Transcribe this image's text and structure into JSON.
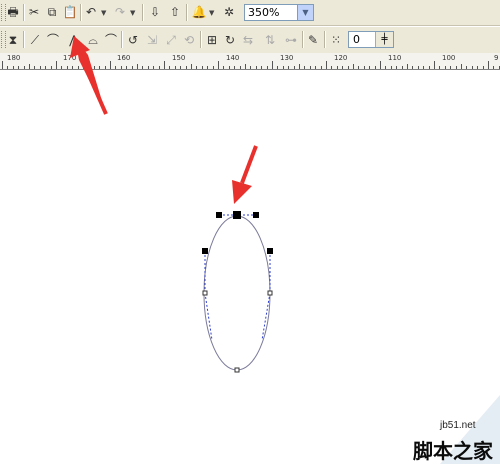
{
  "toolbar_standard": {
    "items": [
      {
        "name": "print-icon",
        "glyph": "🖶"
      },
      {
        "name": "cut-icon",
        "glyph": "✂"
      },
      {
        "name": "copy-icon",
        "glyph": "⧉"
      },
      {
        "name": "paste-icon",
        "glyph": "📋"
      },
      {
        "name": "undo-icon",
        "glyph": "↶"
      },
      {
        "name": "redo-icon",
        "glyph": "↷"
      },
      {
        "name": "import-icon",
        "glyph": "⇩"
      },
      {
        "name": "export-icon",
        "glyph": "⇧"
      },
      {
        "name": "application-launcher-icon",
        "glyph": "🔔"
      },
      {
        "name": "welcome-screen-icon",
        "glyph": "✲"
      }
    ],
    "zoom_value": "350%"
  },
  "toolbar_property": {
    "items": [
      {
        "name": "node-select-icon",
        "glyph": "⧗"
      },
      {
        "name": "to-line-icon",
        "glyph": "⟋"
      },
      {
        "name": "to-curve-icon",
        "glyph": "⌒"
      },
      {
        "name": "make-node-cusp-icon",
        "glyph": "⋀"
      },
      {
        "name": "make-node-smooth-icon",
        "glyph": "⌓"
      },
      {
        "name": "make-node-symmetrical-icon",
        "glyph": "⌒"
      },
      {
        "name": "reverse-direction-icon",
        "glyph": "↺"
      },
      {
        "name": "extract-subpath-icon",
        "glyph": "⇲"
      },
      {
        "name": "stretch-nodes-icon",
        "glyph": "⤢"
      },
      {
        "name": "rotate-nodes-icon",
        "glyph": "⟲"
      },
      {
        "name": "align-nodes-icon",
        "glyph": "⊞"
      },
      {
        "name": "elastic-mode-icon",
        "glyph": "↻"
      },
      {
        "name": "reflect-horizontal-icon",
        "glyph": "⇆"
      },
      {
        "name": "reflect-vertical-icon",
        "glyph": "⇅"
      },
      {
        "name": "auto-close-icon",
        "glyph": "⊶"
      },
      {
        "name": "curve-smoothness-icon",
        "glyph": "⁞"
      },
      {
        "name": "edit-pen-icon",
        "glyph": "✎"
      },
      {
        "name": "select-all-nodes-icon",
        "glyph": "⁙"
      }
    ],
    "spin_value": "0"
  },
  "ruler": {
    "labels": [
      "180",
      "170",
      "160",
      "150",
      "140",
      "130",
      "120",
      "110",
      "100",
      "9"
    ]
  },
  "watermark": {
    "site": "jb51.net",
    "brand": "脚本之家"
  },
  "colors": {
    "toolbar_bg": "#ece9d8",
    "arrow_red": "#e8312c",
    "path_blue": "#2e3ecb",
    "ellipse_stroke": "#7a7a9a"
  }
}
